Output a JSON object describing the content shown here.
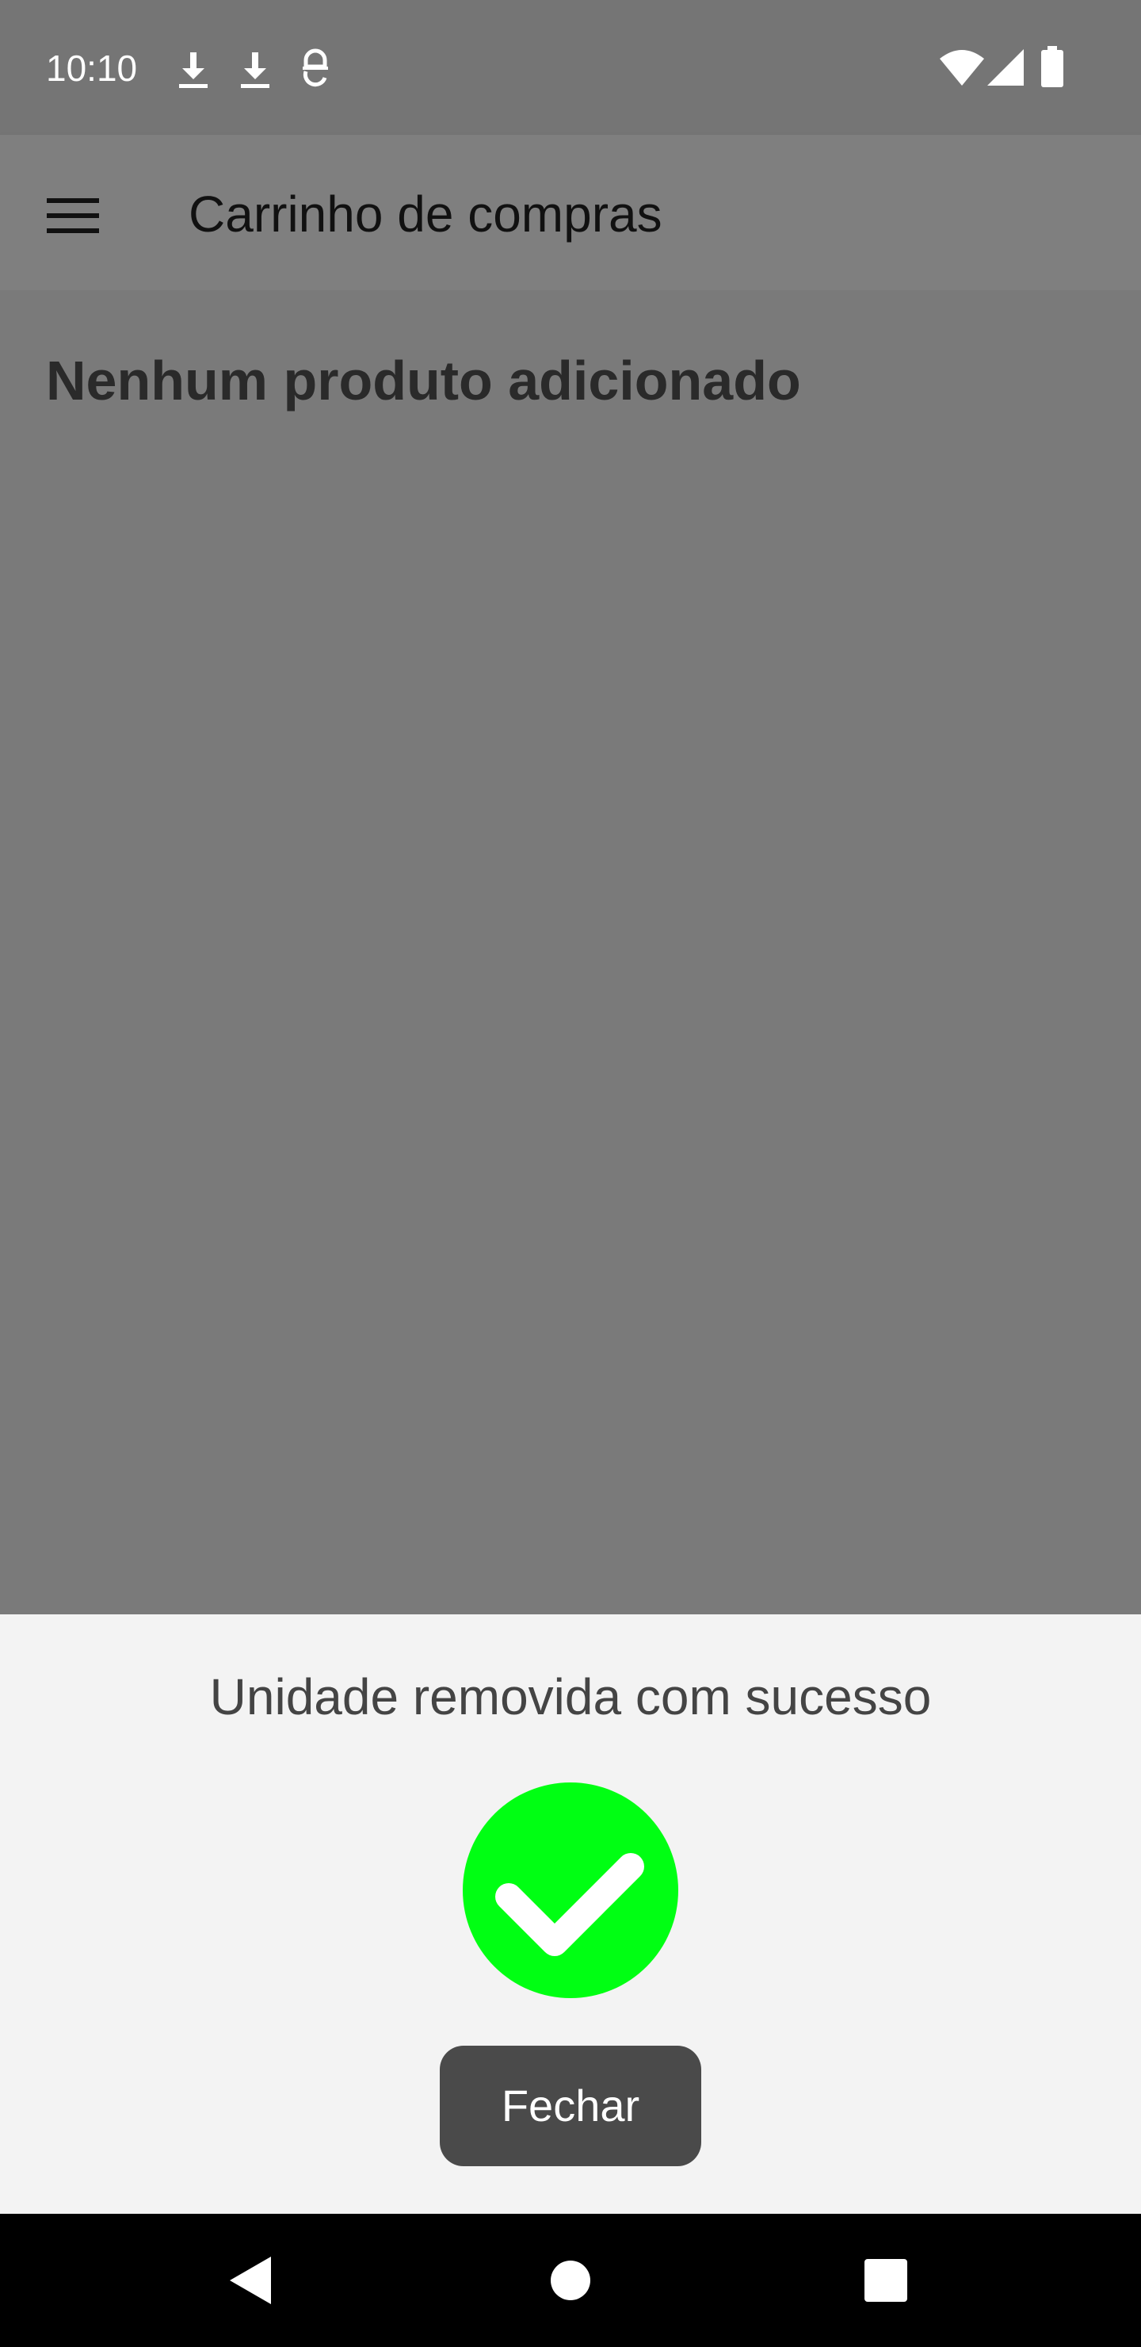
{
  "status_bar": {
    "time": "10:10",
    "left_icons": [
      "download-icon",
      "download-icon",
      "app-notification-icon"
    ],
    "right_icons": [
      "wifi-icon",
      "cell-signal-icon",
      "battery-icon"
    ]
  },
  "app_bar": {
    "menu_icon": "hamburger-menu-icon",
    "title": "Carrinho de compras"
  },
  "content": {
    "empty_message": "Nenhum produto adicionado"
  },
  "bottom_sheet": {
    "message": "Unidade removida com sucesso",
    "icon": "check-circle-icon",
    "icon_color": "#00ff13",
    "close_label": "Fechar"
  },
  "nav_bar": {
    "buttons": [
      "back-icon",
      "home-icon",
      "recents-icon"
    ]
  }
}
